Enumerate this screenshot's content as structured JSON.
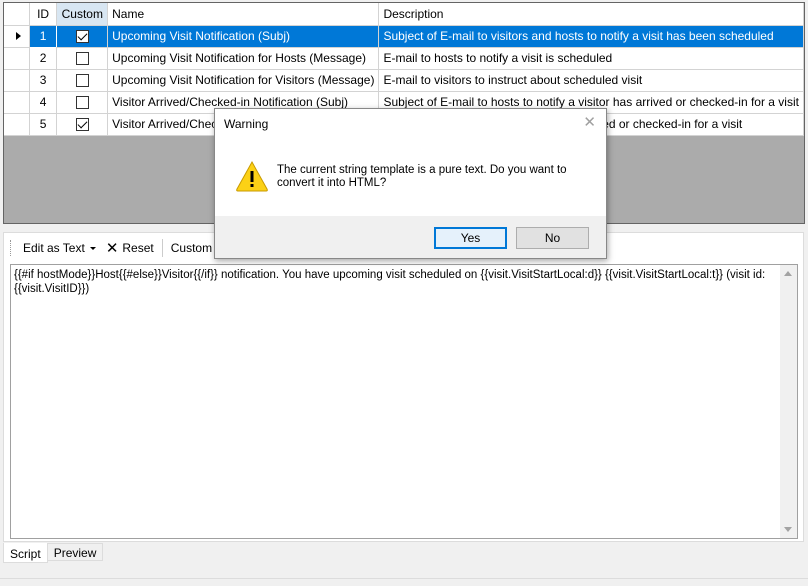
{
  "grid": {
    "columns": {
      "id": "ID",
      "custom": "Custom",
      "name": "Name",
      "description": "Description"
    },
    "rows": [
      {
        "id": "1",
        "custom": true,
        "name": "Upcoming Visit Notification (Subj)",
        "description": "Subject of E-mail to visitors and hosts to notify a visit has been scheduled",
        "selected": true
      },
      {
        "id": "2",
        "custom": false,
        "name": "Upcoming Visit Notification for Hosts (Message)",
        "description": "E-mail to hosts to notify a visit is scheduled",
        "selected": false
      },
      {
        "id": "3",
        "custom": false,
        "name": "Upcoming Visit Notification for Visitors (Message)",
        "description": "E-mail to visitors to instruct about scheduled visit",
        "selected": false
      },
      {
        "id": "4",
        "custom": false,
        "name": "Visitor Arrived/Checked-in Notification (Subj)",
        "description": "Subject of E-mail to hosts to notify a visitor has arrived or checked-in for a visit",
        "selected": false
      },
      {
        "id": "5",
        "custom": true,
        "name": "Visitor Arrived/Checked-in Notification (Message)",
        "description": "E-mail to hosts to notify a visitor has arrived or checked-in for a visit",
        "selected": false
      }
    ]
  },
  "toolbar": {
    "edit_as": "Edit as Text",
    "reset": "Reset",
    "custom": "Custom Re"
  },
  "editor": {
    "content": "{{#if hostMode}}Host{{#else}}Visitor{{/if}} notification. You have upcoming visit scheduled on {{visit.VisitStartLocal:d}} {{visit.VisitStartLocal:t}} (visit id: {{visit.VisitID}})"
  },
  "tabs": {
    "script": "Script",
    "preview": "Preview"
  },
  "dialog": {
    "title": "Warning",
    "close": "✕",
    "message": "The current string template is a pure text. Do you want to convert it into HTML?",
    "yes": "Yes",
    "no": "No",
    "icon": "warning-icon"
  },
  "colors": {
    "selection": "#0078d7",
    "grid_bg": "#ababab",
    "warning": "#fcd116"
  }
}
